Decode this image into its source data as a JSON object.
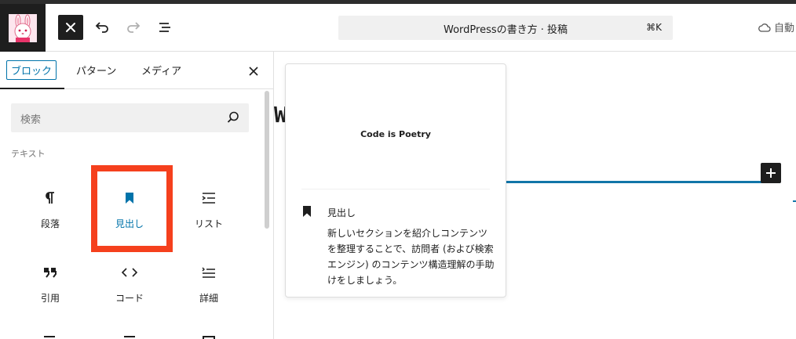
{
  "header": {
    "close_label": "×",
    "command_title": "WordPressの書き方 · 投稿",
    "command_shortcut": "⌘K",
    "autosave_label": "自動"
  },
  "inserter": {
    "tabs": [
      {
        "label": "ブロック"
      },
      {
        "label": "パターン"
      },
      {
        "label": "メディア"
      }
    ],
    "search_placeholder": "検索",
    "category_label": "テキスト",
    "blocks": [
      {
        "label": "段落",
        "icon": "paragraph-icon"
      },
      {
        "label": "見出し",
        "icon": "heading-bookmark-icon"
      },
      {
        "label": "リスト",
        "icon": "list-icon"
      },
      {
        "label": "引用",
        "icon": "quote-icon"
      },
      {
        "label": "コード",
        "icon": "code-icon"
      },
      {
        "label": "詳細",
        "icon": "details-icon"
      }
    ]
  },
  "canvas": {
    "visible_letter": "W"
  },
  "preview": {
    "sample_text": "Code is Poetry",
    "block_name": "見出し",
    "description": "新しいセクションを紹介しコンテンツを整理することで、訪問者 (および検索エンジン) のコンテンツ構造理解の手助けをしましょう。"
  },
  "colors": {
    "accent": "#0073aa",
    "highlight": "#f5401d",
    "dark": "#1e1e1e"
  }
}
